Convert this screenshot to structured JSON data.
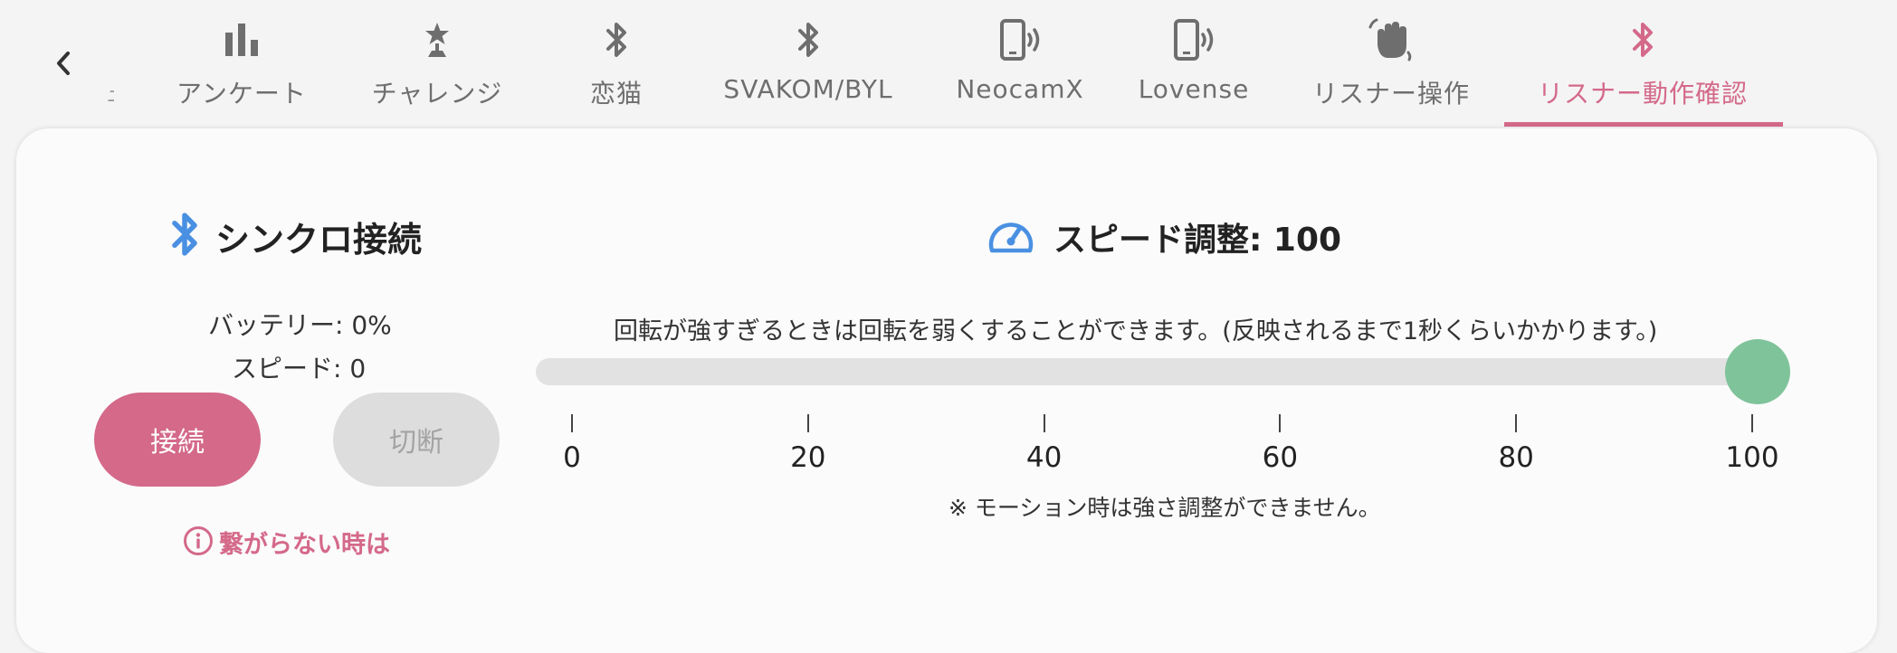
{
  "tabs": [
    {
      "label": "アンケート",
      "icon": "bar-chart-icon"
    },
    {
      "label": "チャレンジ",
      "icon": "trophy-icon"
    },
    {
      "label": "恋猫",
      "icon": "bluetooth-icon"
    },
    {
      "label": "SVAKOM/BYL",
      "icon": "bluetooth-icon"
    },
    {
      "label": "NeocamX",
      "icon": "phone-vibrate-icon"
    },
    {
      "label": "Lovense",
      "icon": "phone-vibrate-icon"
    },
    {
      "label": "リスナー操作",
      "icon": "waving-hand-icon"
    },
    {
      "label": "リスナー動作確認",
      "icon": "bluetooth-icon",
      "active": true
    }
  ],
  "connection": {
    "title": "シンクロ接続",
    "battery": "バッテリー: 0%",
    "speed": "スピード: 0",
    "connect_label": "接続",
    "disconnect_label": "切断",
    "help_label": "繋がらない時は"
  },
  "speed_control": {
    "title": "スピード調整: 100",
    "description": "回転が強すぎるときは回転を弱くすることができます。(反映されるまで1秒くらいかかります。)",
    "value": 100,
    "min": 0,
    "max": 100,
    "ticks": [
      "0",
      "20",
      "40",
      "60",
      "80",
      "100"
    ],
    "note": "※ モーション時は強さ調整ができません。"
  },
  "colors": {
    "accent": "#d4698a",
    "bluetooth_blue": "#4a90e2",
    "slider_thumb": "#7fc39a",
    "inactive_tab": "#6e6e6e"
  }
}
